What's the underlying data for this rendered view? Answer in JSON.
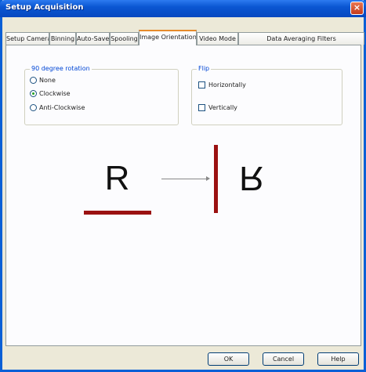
{
  "window": {
    "title": "Setup Acquisition",
    "close_label": "×"
  },
  "tabs": [
    {
      "label": "Setup Camera",
      "active": false
    },
    {
      "label": "Binning",
      "active": false
    },
    {
      "label": "Auto-Save",
      "active": false
    },
    {
      "label": "Spooling",
      "active": false
    },
    {
      "label": "Image Orientation",
      "active": true
    },
    {
      "label": "Video Mode",
      "active": false
    },
    {
      "label": "Data Averaging Filters",
      "active": false
    }
  ],
  "rotation_group": {
    "title": "90 degree rotation",
    "options": [
      {
        "label": "None",
        "checked": false
      },
      {
        "label": "Clockwise",
        "checked": true
      },
      {
        "label": "Anti-Clockwise",
        "checked": false
      }
    ]
  },
  "flip_group": {
    "title": "Flip",
    "options": [
      {
        "label": "Horizontally",
        "checked": false
      },
      {
        "label": "Vertically",
        "checked": false
      }
    ]
  },
  "diagram": {
    "source_letter": "R",
    "result_letter": "R",
    "marker_color": "#9b1111"
  },
  "buttons": {
    "ok": "OK",
    "cancel": "Cancel",
    "help": "Help"
  },
  "colors": {
    "titlebar": "#0a56d2",
    "active_tab_accent": "#e68b2c",
    "group_label": "#0046d5"
  }
}
